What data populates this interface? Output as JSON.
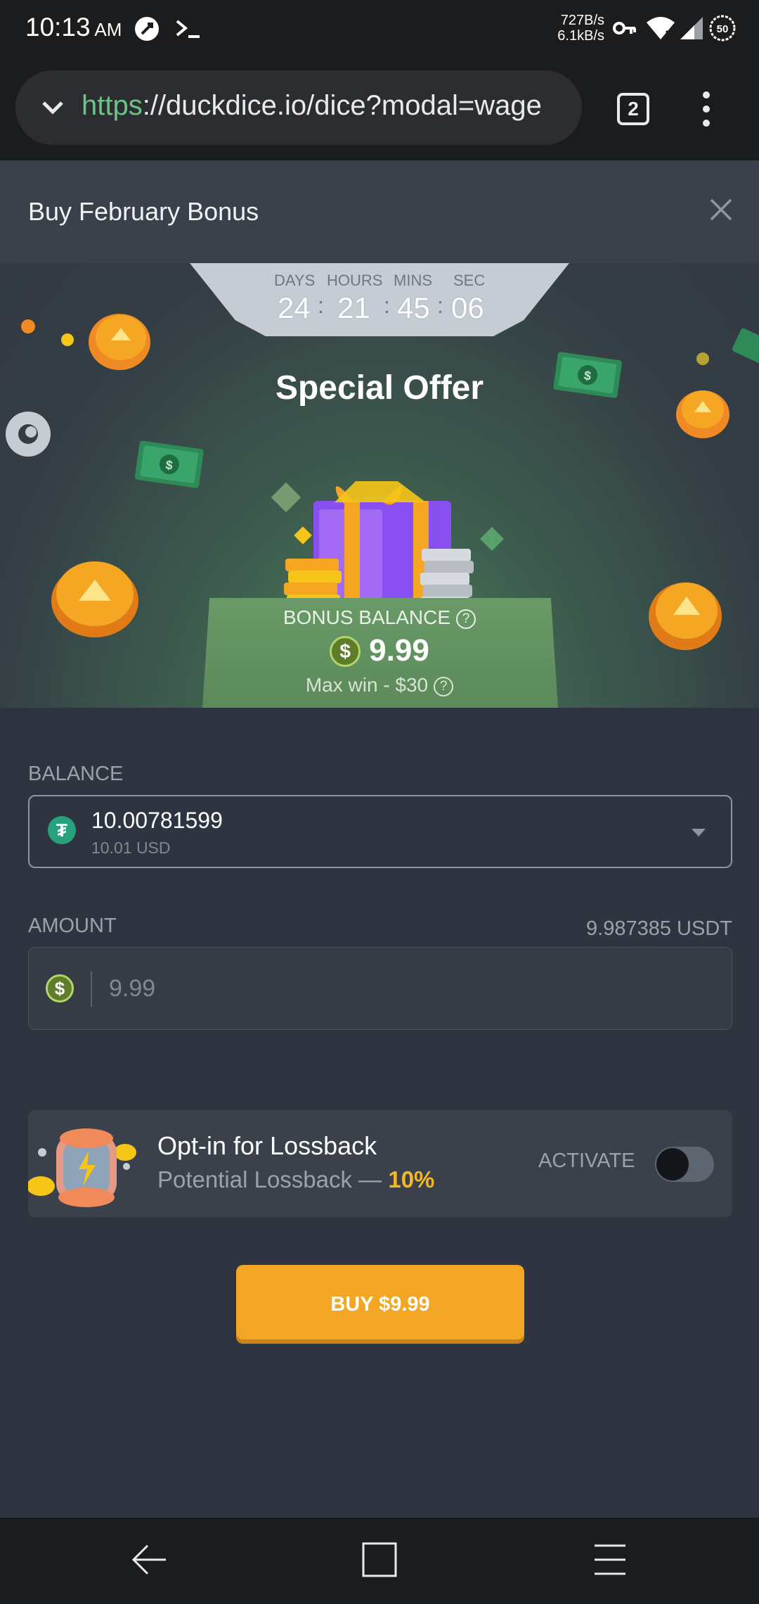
{
  "status_bar": {
    "time": "10:13",
    "ampm": "AM",
    "speed_up": "727B/s",
    "speed_down": "6.1kB/s",
    "battery": "50",
    "icons": [
      "dnd-icon",
      "terminal-icon",
      "vpn-key-icon",
      "wifi-icon",
      "signal-icon",
      "battery-icon"
    ]
  },
  "browser": {
    "url_scheme": "https",
    "url_rest": "://duckdice.io/dice?modal=wage",
    "tab_count": "2"
  },
  "modal": {
    "title": "Buy February Bonus"
  },
  "timer": {
    "labels": [
      "DAYS",
      "HOURS",
      "MINS",
      "SEC"
    ],
    "days": "24",
    "hours": "21",
    "mins": "45",
    "secs": "06",
    "sep": ":"
  },
  "hero": {
    "title": "Special Offer",
    "bonus_label": "BONUS BALANCE",
    "bonus_amount": "9.99",
    "max_win": "Max win - $30"
  },
  "balance": {
    "label": "BALANCE",
    "amount": "10.00781599",
    "usd": "10.01 USD",
    "currency_icon": "tether-icon"
  },
  "amount": {
    "label": "AMOUNT",
    "available": "9.987385 USDT",
    "placeholder": "9.99"
  },
  "lossback": {
    "title": "Opt-in for Lossback",
    "subtitle": "Potential Lossback —",
    "percent": "10%",
    "activate_label": "ACTIVATE",
    "enabled": false
  },
  "buy_button": {
    "label": "BUY $9.99"
  },
  "colors": {
    "accent": "#f3a623",
    "background": "#2f3540",
    "panel": "#3a414b",
    "bonus_green": "#6a9a68"
  }
}
